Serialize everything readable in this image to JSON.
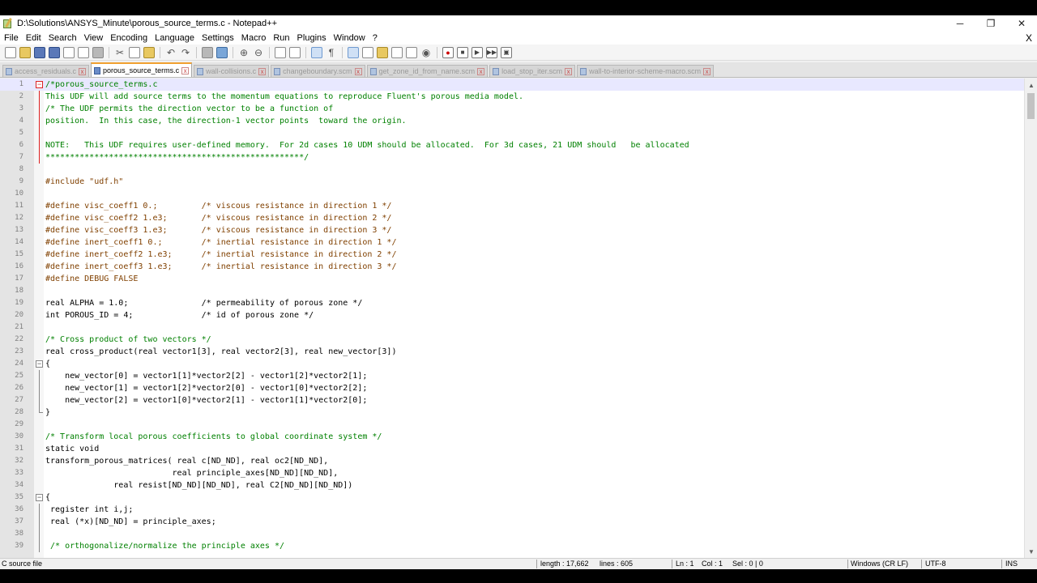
{
  "window": {
    "title": "D:\\Solutions\\ANSYS_Minute\\porous_source_terms.c - Notepad++",
    "minimize": "─",
    "restore": "❐",
    "close": "✕"
  },
  "menu": {
    "items": [
      "File",
      "Edit",
      "Search",
      "View",
      "Encoding",
      "Language",
      "Settings",
      "Macro",
      "Run",
      "Plugins",
      "Window",
      "?"
    ],
    "close": "X"
  },
  "tabs": [
    {
      "label": "access_residuals.c",
      "active": false
    },
    {
      "label": "porous_source_terms.c",
      "active": true
    },
    {
      "label": "wall-collisions.c",
      "active": false
    },
    {
      "label": "changeboundary.scm",
      "active": false
    },
    {
      "label": "get_zone_id_from_name.scm",
      "active": false
    },
    {
      "label": "load_stop_iter.scm",
      "active": false
    },
    {
      "label": "wall-to-interior-scheme-macro.scm",
      "active": false
    }
  ],
  "tab_close": "x",
  "editor": {
    "lines": [
      {
        "n": "1",
        "t": "/*porous_source_terms.c",
        "k": "comment"
      },
      {
        "n": "2",
        "t": "This UDF will add source terms to the momentum equations to reproduce Fluent's porous media model.",
        "k": "comment"
      },
      {
        "n": "3",
        "t": "/* The UDF permits the direction vector to be a function of",
        "k": "comment"
      },
      {
        "n": "4",
        "t": "position.  In this case, the direction-1 vector points  toward the origin.",
        "k": "comment"
      },
      {
        "n": "5",
        "t": "",
        "k": "comment"
      },
      {
        "n": "6",
        "t": "NOTE:   This UDF requires user-defined memory.  For 2d cases 10 UDM should be allocated.  For 3d cases, 21 UDM should   be allocated",
        "k": "comment"
      },
      {
        "n": "7",
        "t": "*****************************************************/",
        "k": "comment"
      },
      {
        "n": "8",
        "t": "",
        "k": "plain"
      },
      {
        "n": "9",
        "t": "#include \"udf.h\"",
        "k": "pre"
      },
      {
        "n": "10",
        "t": "",
        "k": "plain"
      },
      {
        "n": "11",
        "t": "#define visc_coeff1 0.;         /* viscous resistance in direction 1 */",
        "k": "pre"
      },
      {
        "n": "12",
        "t": "#define visc_coeff2 1.e3;       /* viscous resistance in direction 2 */",
        "k": "pre"
      },
      {
        "n": "13",
        "t": "#define visc_coeff3 1.e3;       /* viscous resistance in direction 3 */",
        "k": "pre"
      },
      {
        "n": "14",
        "t": "#define inert_coeff1 0.;        /* inertial resistance in direction 1 */",
        "k": "pre"
      },
      {
        "n": "15",
        "t": "#define inert_coeff2 1.e3;      /* inertial resistance in direction 2 */",
        "k": "pre"
      },
      {
        "n": "16",
        "t": "#define inert_coeff3 1.e3;      /* inertial resistance in direction 3 */",
        "k": "pre"
      },
      {
        "n": "17",
        "t": "#define DEBUG FALSE",
        "k": "pre"
      },
      {
        "n": "18",
        "t": "",
        "k": "plain"
      },
      {
        "n": "19",
        "t": "real ALPHA = 1.0;               /* permeability of porous zone */",
        "k": "plain"
      },
      {
        "n": "20",
        "t": "int POROUS_ID = 4;              /* id of porous zone */",
        "k": "plain"
      },
      {
        "n": "21",
        "t": "",
        "k": "plain"
      },
      {
        "n": "22",
        "t": "/* Cross product of two vectors */",
        "k": "comment"
      },
      {
        "n": "23",
        "t": "real cross_product(real vector1[3], real vector2[3], real new_vector[3])",
        "k": "plain"
      },
      {
        "n": "24",
        "t": "{",
        "k": "plain"
      },
      {
        "n": "25",
        "t": "    new_vector[0] = vector1[1]*vector2[2] - vector1[2]*vector2[1];",
        "k": "plain"
      },
      {
        "n": "26",
        "t": "    new_vector[1] = vector1[2]*vector2[0] - vector1[0]*vector2[2];",
        "k": "plain"
      },
      {
        "n": "27",
        "t": "    new_vector[2] = vector1[0]*vector2[1] - vector1[1]*vector2[0];",
        "k": "plain"
      },
      {
        "n": "28",
        "t": "}",
        "k": "plain"
      },
      {
        "n": "29",
        "t": "",
        "k": "plain"
      },
      {
        "n": "30",
        "t": "/* Transform local porous coefficients to global coordinate system */",
        "k": "comment"
      },
      {
        "n": "31",
        "t": "static void",
        "k": "plain"
      },
      {
        "n": "32",
        "t": "transform_porous_matrices( real c[ND_ND], real oc2[ND_ND],",
        "k": "plain"
      },
      {
        "n": "33",
        "t": "                          real principle_axes[ND_ND][ND_ND],",
        "k": "plain"
      },
      {
        "n": "34",
        "t": "              real resist[ND_ND][ND_ND], real C2[ND_ND][ND_ND])",
        "k": "plain"
      },
      {
        "n": "35",
        "t": "{",
        "k": "plain"
      },
      {
        "n": "36",
        "t": " register int i,j;",
        "k": "plain"
      },
      {
        "n": "37",
        "t": " real (*x)[ND_ND] = principle_axes;",
        "k": "plain"
      },
      {
        "n": "38",
        "t": "",
        "k": "plain"
      },
      {
        "n": "39",
        "t": " /* orthogonalize/normalize the principle axes */",
        "k": "comment"
      }
    ]
  },
  "status": {
    "type": "C source file",
    "length": "length : 17,662",
    "lines": "lines : 605",
    "ln": "Ln : 1",
    "col": "Col : 1",
    "sel": "Sel : 0 | 0",
    "eol": "Windows (CR LF)",
    "encoding": "UTF-8",
    "mode": "INS"
  }
}
